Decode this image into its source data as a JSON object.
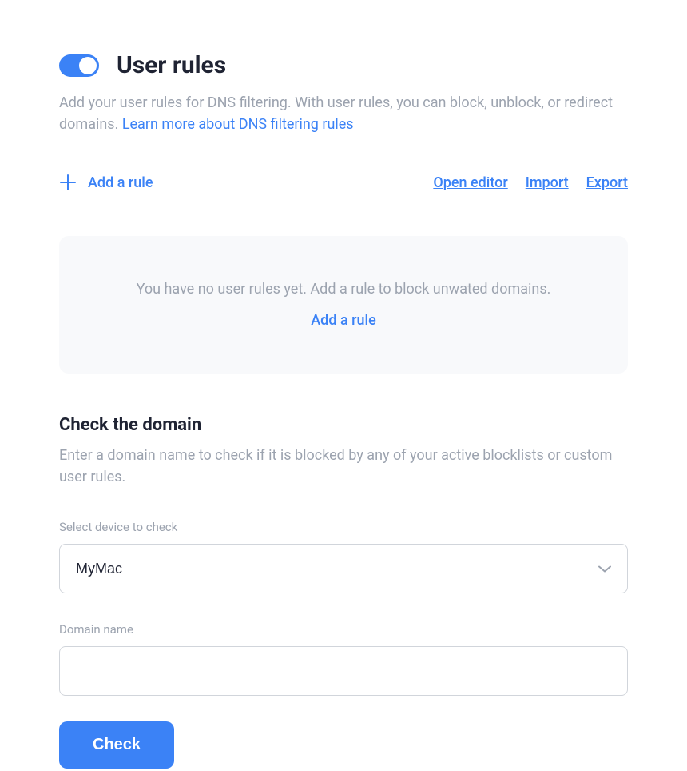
{
  "header": {
    "title": "User rules",
    "toggle_on": true
  },
  "description": {
    "text": "Add your user rules for DNS filtering. With user rules, you can block, unblock, or redirect domains. ",
    "link_text": "Learn more about DNS filtering rules"
  },
  "toolbar": {
    "add_rule_label": "Add a rule",
    "open_editor_label": "Open editor",
    "import_label": "Import",
    "export_label": "Export"
  },
  "empty_state": {
    "message": "You have no user rules yet. Add a rule to block unwated domains.",
    "link_label": "Add a rule"
  },
  "check_domain": {
    "title": "Check the domain",
    "description": "Enter a domain name to check if it is blocked by any of your active blocklists or custom user rules.",
    "device_label": "Select device to check",
    "device_selected": "MyMac",
    "domain_label": "Domain name",
    "domain_value": "",
    "button_label": "Check"
  }
}
